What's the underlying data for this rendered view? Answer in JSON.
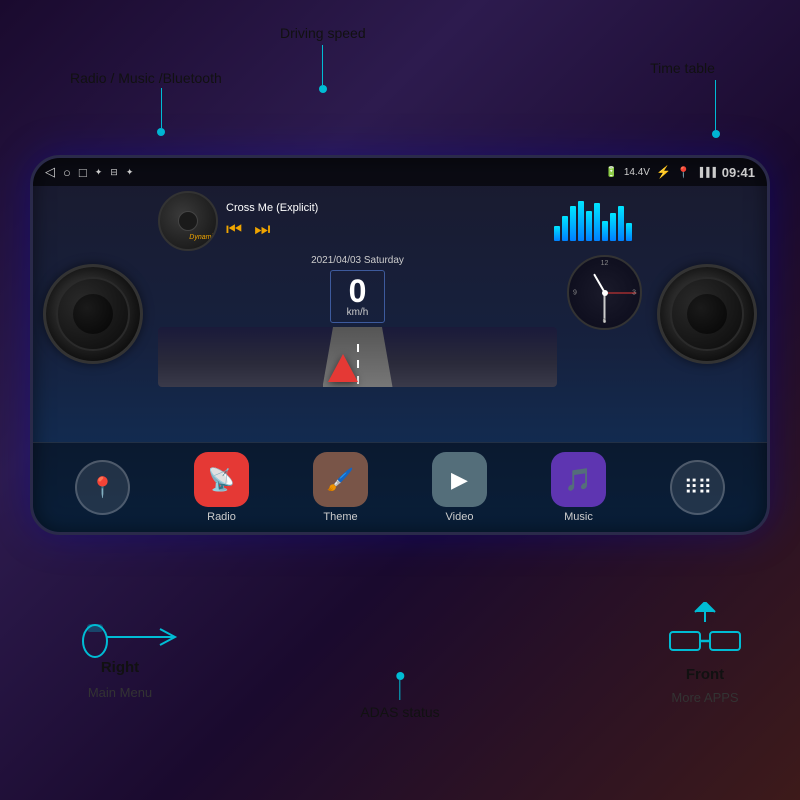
{
  "labels": {
    "driving_speed": "Driving speed",
    "radio_music_bt": "Radio / Music /Bluetooth",
    "time_table": "Time table",
    "main_menu": "Main Menu",
    "adas_status": "ADAS status",
    "more_apps": "More APPS",
    "right_label": "Right",
    "front_label": "Front"
  },
  "status_bar": {
    "back_icon": "◁",
    "home_icon": "○",
    "recent_icon": "□",
    "usb_icon": "✦",
    "media_icon": "⊟",
    "usb2_icon": "✦",
    "battery": "14.4V",
    "bt_icon": "*",
    "location_icon": "⊙",
    "signal": "▐▐▐",
    "time": "09:41"
  },
  "music": {
    "song_title": "Cross Me (Explicit)",
    "prev_icon": "⏮",
    "next_icon": "⏭",
    "vinyl_label": "Dynami"
  },
  "speed": {
    "date": "2021/04/03  Saturday",
    "value": "0",
    "unit": "km/h"
  },
  "apps": [
    {
      "name": "location-app",
      "label": "",
      "color": "#37474f",
      "icon": "📍"
    },
    {
      "name": "radio-app",
      "label": "Radio",
      "color": "#e53935",
      "icon": "📡"
    },
    {
      "name": "theme-app",
      "label": "Theme",
      "color": "#795548",
      "icon": "🖌"
    },
    {
      "name": "video-app",
      "label": "Video",
      "color": "#546e7a",
      "icon": "▶"
    },
    {
      "name": "music-app",
      "label": "Music",
      "color": "#5e35b1",
      "icon": "🎵"
    },
    {
      "name": "more-apps",
      "label": "",
      "color": "#37474f",
      "icon": "⠿"
    }
  ],
  "eq_bars": [
    15,
    25,
    35,
    40,
    30,
    38,
    20,
    28,
    35,
    18
  ],
  "colors": {
    "accent": "#00bcd4",
    "bg_dark": "#1a0a2e",
    "device_bg": "#1a1a2e"
  }
}
